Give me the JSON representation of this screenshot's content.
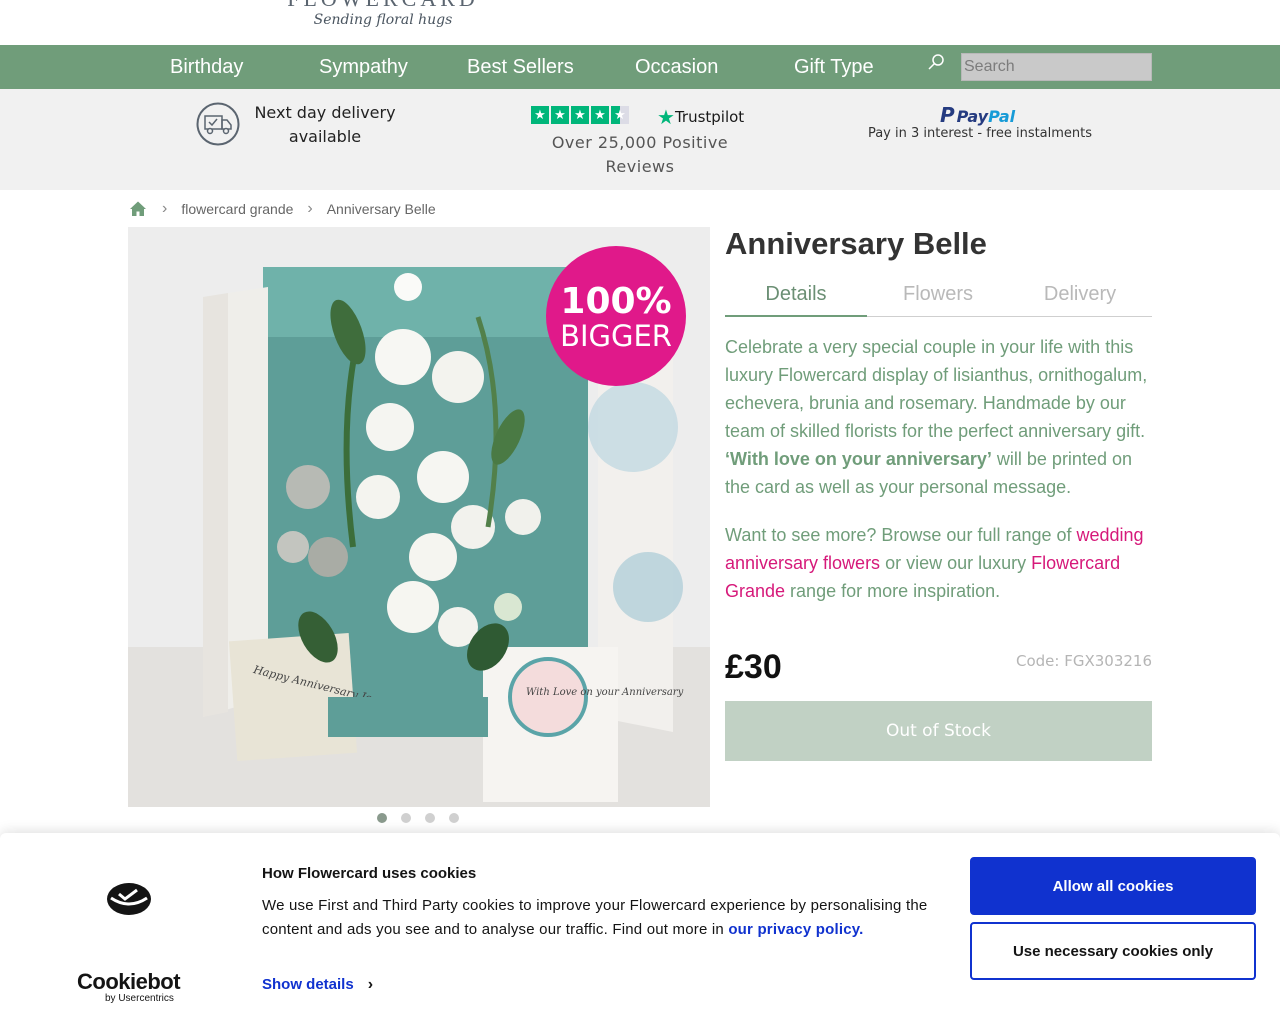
{
  "header": {
    "logo_word": "FLOWERCARD",
    "logo_tagline": "Sending floral hugs"
  },
  "nav": {
    "items": [
      {
        "label": "Birthday"
      },
      {
        "label": "Sympathy"
      },
      {
        "label": "Best Sellers"
      },
      {
        "label": "Occasion"
      },
      {
        "label": "Gift Type"
      }
    ],
    "search_placeholder": "Search"
  },
  "trust_bar": {
    "delivery": "Next day delivery available",
    "trustpilot_name": "Trustpilot",
    "trustpilot_rating_stars": 4.5,
    "reviews": "Over 25,000 Positive Reviews",
    "paypal_name_1": "Pay",
    "paypal_name_2": "Pal",
    "paypal_text": "Pay in 3 interest - free instalments"
  },
  "breadcrumb": {
    "items": [
      "flowercard grande",
      "Anniversary Belle"
    ]
  },
  "product": {
    "image_badge_line1": "100%",
    "image_badge_line2": "BIGGER",
    "card_note": "Happy Anniversary Jenna and George! Love Richard and Liz xx",
    "card_stamp": "With Love on your Anniversary",
    "carousel_dots": 4,
    "carousel_active_index": 0,
    "title": "Anniversary Belle",
    "tabs": [
      {
        "label": "Details",
        "active": true
      },
      {
        "label": "Flowers",
        "active": false
      },
      {
        "label": "Delivery",
        "active": false
      }
    ],
    "description_main": "Celebrate a very special couple in your life with this luxury Flowercard display of lisianthus, ornithogalum, echevera, brunia and rosemary. Handmade by our team of skilled florists for the perfect anniversary gift. ",
    "description_bold": "‘With love on your anniversary’",
    "description_end": " will be printed on the card as well as your personal message.",
    "more_prefix": "Want to see more? Browse our full range of ",
    "more_link1": "wedding anniversary flowers",
    "more_middle": " or view our luxury ",
    "more_link2": "Flowercard Grande",
    "more_suffix": " range for more inspiration.",
    "price": "£30",
    "code": "Code: FGX303216",
    "stock_button": "Out of Stock"
  },
  "cookie_banner": {
    "brand_name": "Cookiebot",
    "brand_by": "by Usercentrics",
    "title": "How Flowercard uses cookies",
    "body": "We use First and Third Party cookies to improve your Flowercard experience by personalising the content and ads you see and to analyse our traffic. Find out more in ",
    "privacy_link": "our privacy policy.",
    "show_details": "Show details",
    "allow_all": "Allow all cookies",
    "necessary_only": "Use necessary cookies only"
  },
  "colors": {
    "brand_green": "#709d7a",
    "link_pink": "#d6197a",
    "cookie_blue": "#1032cf",
    "out_of_stock_bg": "#c1d1c4",
    "trustpilot_green": "#00b67a",
    "badge_pink": "#e0198a"
  },
  "icons": {
    "search": "search-icon",
    "truck": "delivery-truck-icon",
    "home": "home-icon",
    "breadcrumb_separator": "chevron-right-icon",
    "show_details": "chevron-right-icon"
  }
}
